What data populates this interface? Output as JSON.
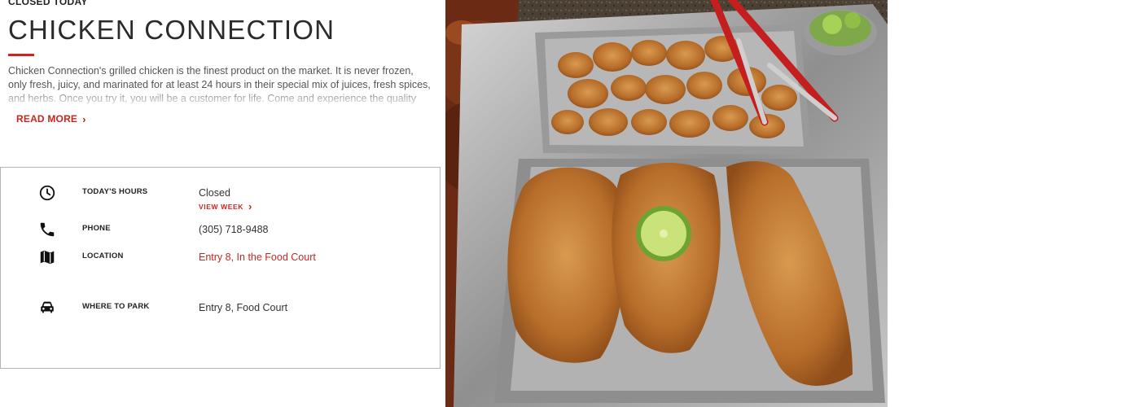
{
  "header": {
    "status": "CLOSED TODAY",
    "title": "CHICKEN CONNECTION"
  },
  "description": {
    "text": "Chicken Connection's grilled chicken is the finest product on the market. It is never frozen, only fresh, juicy, and marinated for at least 24 hours in their special mix of juices, fresh spices, and herbs. Once you try it, you will be a customer for life. Come and experience the quality food.",
    "read_more": "READ MORE"
  },
  "info": {
    "hours": {
      "icon": "clock-icon",
      "label": "TODAY'S HOURS",
      "value": "Closed",
      "view_week": "VIEW WEEK"
    },
    "phone": {
      "icon": "phone-icon",
      "label": "PHONE",
      "value": "(305) 718-9488"
    },
    "location": {
      "icon": "map-icon",
      "label": "LOCATION",
      "value": "Entry 8, In the Food Court"
    },
    "parking": {
      "icon": "car-icon",
      "label": "WHERE TO PARK",
      "value": "Entry 8, Food Court"
    }
  },
  "colors": {
    "accent": "#c8271e",
    "text": "#333333",
    "border": "#b5b5b5"
  }
}
